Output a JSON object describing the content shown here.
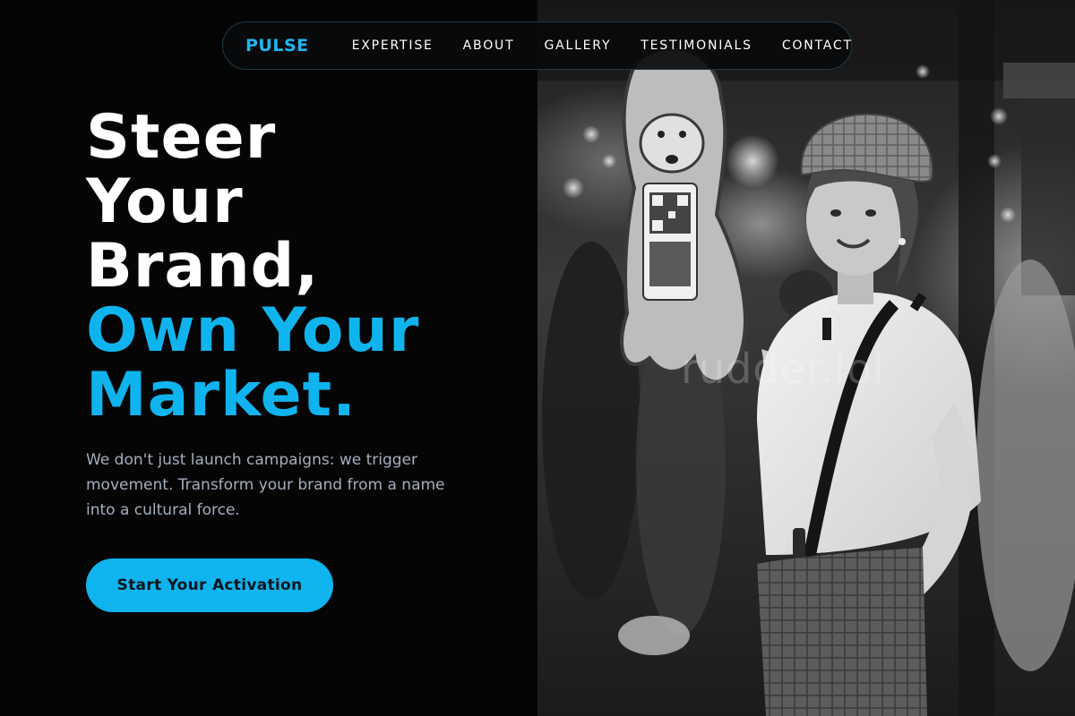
{
  "nav": {
    "brand": "PULSE",
    "links": [
      "EXPERTISE",
      "ABOUT",
      "GALLERY",
      "TESTIMONIALS",
      "CONTACT"
    ]
  },
  "hero": {
    "headline_lines": [
      "Steer",
      "Your",
      "Brand,"
    ],
    "accent_lines": [
      "Own Your",
      "Market."
    ],
    "subtext": "We don't just launch campaigns: we trigger movement. Transform your brand from a name into a cultural force.",
    "cta_label": "Start Your Activation"
  },
  "photo": {
    "watermark": "rudder.lol"
  },
  "colors": {
    "accent": "#0fb4ee",
    "background": "#050506",
    "subtext": "#a3aebd"
  }
}
